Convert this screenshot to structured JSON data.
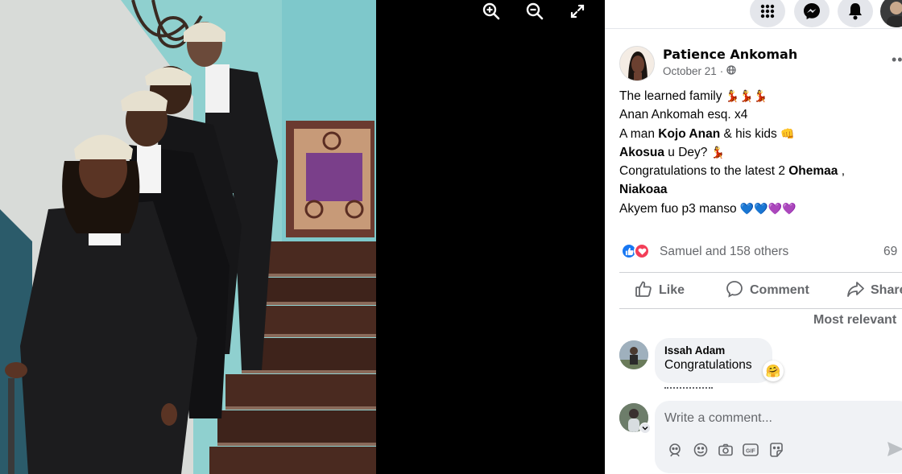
{
  "colors": {
    "brand_blue": "#1877f2",
    "muted_text": "#65676b",
    "love_red": "#f33e58",
    "comment_bg": "#f0f2f5"
  },
  "viewer": {
    "tools": [
      {
        "name": "zoom-in-icon"
      },
      {
        "name": "zoom-out-icon"
      },
      {
        "name": "fullscreen-icon"
      }
    ]
  },
  "topbar": {
    "icons": [
      "menu-grid-icon",
      "messenger-icon",
      "notifications-icon",
      "account-avatar"
    ]
  },
  "post": {
    "author": "Patience Ankomah",
    "date": "October 21",
    "privacy_icon": "globe-icon",
    "lines": {
      "l1": "The learned family",
      "l2": "Anan Ankomah esq. x4",
      "l3_a": "A man ",
      "l3_b": "Kojo Anan",
      "l3_c": " & his kids",
      "l4_a": "Akosua",
      "l4_b": " u Dey?",
      "l5_a": "Congratulations to the latest 2 ",
      "l5_b": "Ohemaa",
      "l5_c": " ,",
      "l6": "Niakoaa",
      "l7": "Akyem fuo p3 manso"
    },
    "emoji": {
      "dancer": "💃",
      "fist": "👊",
      "blue_heart": "💙",
      "purple_heart": "💜"
    }
  },
  "reactions": {
    "summary": "Samuel and 158 others",
    "comment_count": "69",
    "types": [
      "like-icon",
      "love-icon"
    ]
  },
  "actions": {
    "like": "Like",
    "comment": "Comment",
    "share": "Share"
  },
  "comments": {
    "sort_label": "Most relevant",
    "items": [
      {
        "author": "Issah Adam",
        "text": "Congratulations",
        "reaction": "🤗"
      }
    ]
  },
  "composer": {
    "placeholder": "Write a comment...",
    "tools": [
      "avatar-sticker-icon",
      "emoji-icon",
      "camera-icon",
      "gif-icon",
      "sticker-icon",
      "send-icon"
    ]
  }
}
